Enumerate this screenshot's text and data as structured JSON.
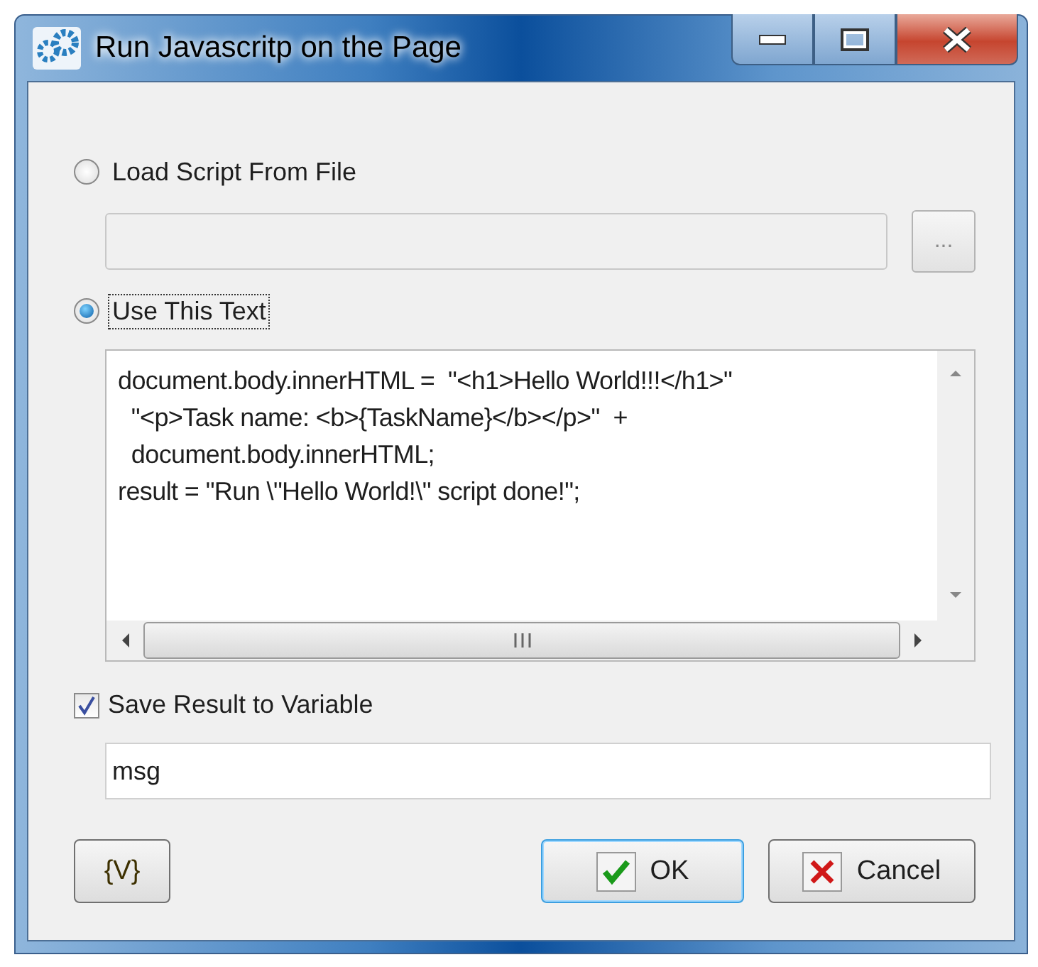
{
  "window": {
    "title": "Run Javascritp on the Page"
  },
  "source_options": [
    {
      "label": "Load Script From File",
      "selected": false
    },
    {
      "label": "Use This Text",
      "selected": true
    }
  ],
  "file_field": {
    "browse_label": "..."
  },
  "script_text": {
    "lines": [
      "document.body.innerHTML =  \"<h1>Hello World!!!</h1>\"",
      "  \"<p>Task name: <b>{TaskName}</b></p>\"  +",
      "  document.body.innerHTML;",
      "result = \"Run \\\"Hello World!\\\" script done!\";"
    ]
  },
  "save_result": {
    "label": "Save Result to Variable",
    "checked": true
  },
  "variable_field": {
    "value": "msg"
  },
  "buttons": [
    {
      "kind": "variables",
      "label": "{V}"
    },
    {
      "kind": "ok",
      "label": "OK"
    },
    {
      "kind": "cancel",
      "label": "Cancel"
    }
  ]
}
